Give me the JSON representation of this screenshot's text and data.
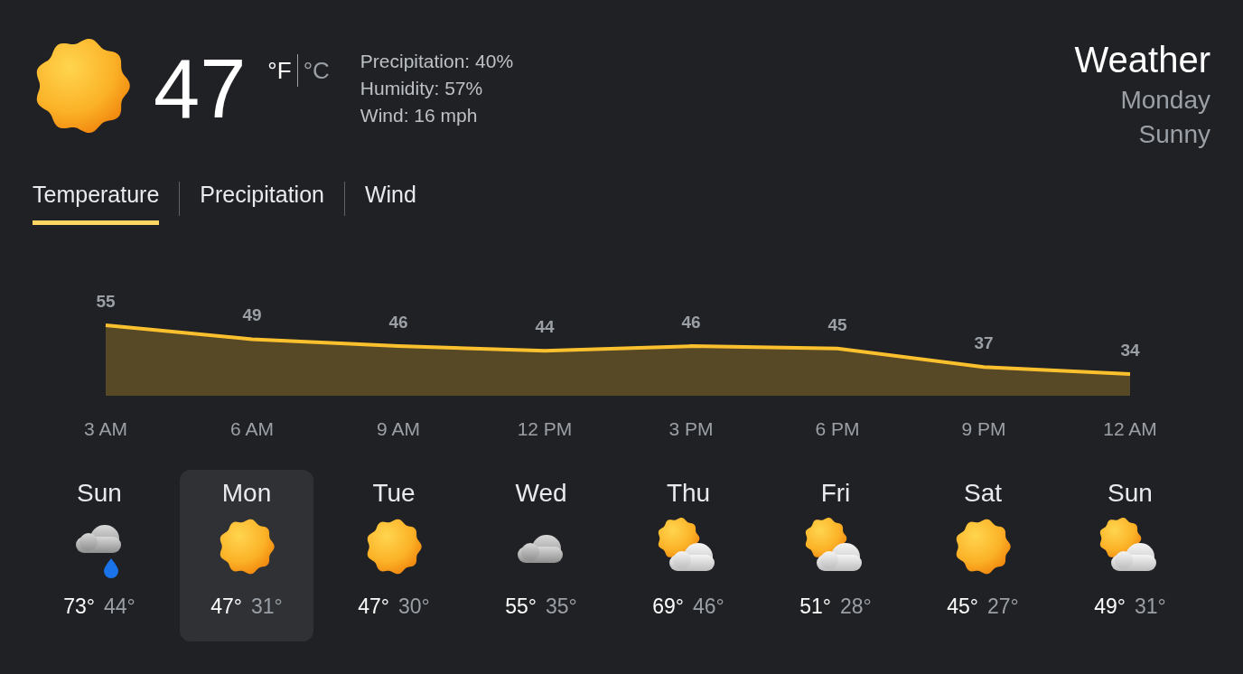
{
  "current": {
    "temperature": "47",
    "units": [
      {
        "label": "°F",
        "selected": true
      },
      {
        "label": "°C",
        "selected": false
      }
    ],
    "details": [
      "Precipitation: 40%",
      "Humidity: 57%",
      "Wind: 16 mph"
    ]
  },
  "header": {
    "title": "Weather",
    "day": "Monday",
    "condition": "Sunny"
  },
  "tabs": [
    {
      "label": "Temperature",
      "selected": true
    },
    {
      "label": "Precipitation",
      "selected": false
    },
    {
      "label": "Wind",
      "selected": false
    }
  ],
  "chart_data": {
    "type": "area",
    "categories": [
      "3 AM",
      "6 AM",
      "9 AM",
      "12 PM",
      "3 PM",
      "6 PM",
      "9 PM",
      "12 AM"
    ],
    "series": [
      {
        "color": "#fbc02d",
        "values": [
          55,
          49,
          46,
          44,
          46,
          45,
          37,
          34
        ]
      }
    ],
    "data_labels": true
  },
  "days": [
    {
      "name": "Sun",
      "kind": "rain",
      "high": "73°",
      "low": "44°",
      "selected": false
    },
    {
      "name": "Mon",
      "kind": "sunny",
      "high": "47°",
      "low": "31°",
      "selected": true
    },
    {
      "name": "Tue",
      "kind": "sunny",
      "high": "47°",
      "low": "30°",
      "selected": false
    },
    {
      "name": "Wed",
      "kind": "cloudy",
      "high": "55°",
      "low": "35°",
      "selected": false
    },
    {
      "name": "Thu",
      "kind": "partly",
      "high": "69°",
      "low": "46°",
      "selected": false
    },
    {
      "name": "Fri",
      "kind": "partly",
      "high": "51°",
      "low": "28°",
      "selected": false
    },
    {
      "name": "Sat",
      "kind": "sunny",
      "high": "45°",
      "low": "27°",
      "selected": false
    },
    {
      "name": "Sun",
      "kind": "partly",
      "high": "49°",
      "low": "31°",
      "selected": false
    }
  ]
}
